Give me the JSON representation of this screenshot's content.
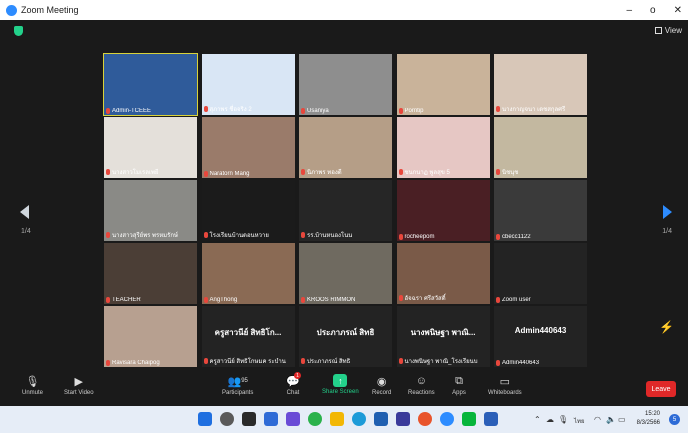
{
  "window": {
    "title": "Zoom Meeting",
    "minimize": "–",
    "maximize": "o",
    "close": "✕"
  },
  "view_label": "View",
  "pages": {
    "left": "1/4",
    "right": "1/4"
  },
  "tiles": [
    {
      "name": "Admin-TCEEE",
      "row": 0,
      "col": 0,
      "active": true,
      "bg": "#2f5b9a"
    },
    {
      "name": "สุภาพร ชื่อจริง 2",
      "row": 0,
      "col": 1,
      "bg": "#d9e6f5"
    },
    {
      "name": "Usaniya",
      "row": 0,
      "col": 2,
      "bg": "#8e8e8e"
    },
    {
      "name": "Porntip",
      "row": 0,
      "col": 3,
      "bg": "#c9b39a"
    },
    {
      "name": "นางกาญจนา เดชสกุลศรี",
      "row": 0,
      "col": 4,
      "bg": "#d8c7b8"
    },
    {
      "name": "นางสาวโมเรลเพยี",
      "row": 1,
      "col": 0,
      "bg": "#e4e0da"
    },
    {
      "name": "Naratorn Mang",
      "row": 1,
      "col": 1,
      "bg": "#9a7b6a"
    },
    {
      "name": "นิภาพร ทองดี",
      "row": 1,
      "col": 2,
      "bg": "#b59e87"
    },
    {
      "name": "ชนกนาฏ พูลสุข 5",
      "row": 1,
      "col": 3,
      "bg": "#e6c7c4"
    },
    {
      "name": "นิชนุช",
      "row": 1,
      "col": 4,
      "bg": "#c3b8a0"
    },
    {
      "name": "นางสาวสุรีย์พร พรหมรักษ์",
      "row": 2,
      "col": 0,
      "bg": "#8a8a86"
    },
    {
      "name": "โรงเรียนบ้านดอนหวาย",
      "row": 2,
      "col": 1,
      "bg": "#1b1b1b"
    },
    {
      "name": "รร.บ้านหนองโนน",
      "row": 2,
      "col": 2,
      "bg": "#262626"
    },
    {
      "name": "rocheepom",
      "row": 2,
      "col": 3,
      "bg": "#4a1f24"
    },
    {
      "name": "cbecc1122",
      "row": 2,
      "col": 4,
      "bg": "#3a3a3a"
    },
    {
      "name": "TEACHER",
      "row": 3,
      "col": 0,
      "bg": "#4b3e36"
    },
    {
      "name": "AngThong",
      "row": 3,
      "col": 1,
      "bg": "#8a6a54"
    },
    {
      "name": "KROOS RIMMON",
      "row": 3,
      "col": 2,
      "bg": "#6f6a60"
    },
    {
      "name": "อัจฉรา ศรีสวัสดิ์",
      "row": 3,
      "col": 3,
      "bg": "#7a5a48"
    },
    {
      "name": "Zoom user",
      "row": 3,
      "col": 4,
      "bg": "#232323"
    },
    {
      "name": "Ravisara Chaipog",
      "row": 4,
      "col": 0,
      "bg": "#b7a090"
    },
    {
      "name": "ครูสาวนีย์ สิทธิโกษมค ระบำน",
      "big": "ครูสาวนีย์ สิทธิโก...",
      "row": 4,
      "col": 1,
      "bg": "#232323"
    },
    {
      "name": "ประภาภรณ์ สิทธิ",
      "big": "ประภาภรณ์ สิทธิ",
      "row": 4,
      "col": 2,
      "bg": "#232323"
    },
    {
      "name": "นางพนิษฐา พาณิ_โรงเรียนบ",
      "big": "นางพนิษฐา พาณิ...",
      "row": 4,
      "col": 3,
      "bg": "#232323"
    },
    {
      "name": "Admin440643",
      "big": "Admin440643",
      "row": 4,
      "col": 4,
      "bg": "#232323"
    }
  ],
  "toolbar": {
    "unmute": "Unmute",
    "start_video": "Start Video",
    "participants": "Participants",
    "participants_count": "95",
    "chat": "Chat",
    "chat_badge": "1",
    "share_screen": "Share Screen",
    "record": "Record",
    "reactions": "Reactions",
    "apps": "Apps",
    "whiteboards": "Whiteboards",
    "leave": "Leave"
  },
  "taskbar": {
    "time": "15:20",
    "date": "8/3/2566",
    "lang": "ไทย",
    "notif_count": "5"
  },
  "colors": {
    "accent": "#2d8cff",
    "share": "#23d18b",
    "leave": "#e02828",
    "active_speaker": "#d8d23a"
  }
}
